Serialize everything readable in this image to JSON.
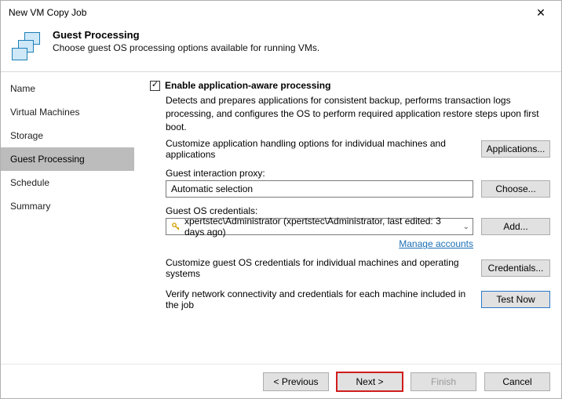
{
  "window": {
    "title": "New VM Copy Job",
    "close_glyph": "✕"
  },
  "header": {
    "title": "Guest Processing",
    "subtitle": "Choose guest OS processing options available for running VMs."
  },
  "sidebar": {
    "items": [
      {
        "label": "Name"
      },
      {
        "label": "Virtual Machines"
      },
      {
        "label": "Storage"
      },
      {
        "label": "Guest Processing",
        "selected": true
      },
      {
        "label": "Schedule"
      },
      {
        "label": "Summary"
      }
    ]
  },
  "content": {
    "enable_checkbox_label": "Enable application-aware processing",
    "enable_checkbox_checked": true,
    "enable_desc": "Detects and prepares applications for consistent backup, performs transaction logs processing, and configures the OS to perform required application restore steps upon first boot.",
    "customize_app_text": "Customize application handling options for individual machines and applications",
    "applications_btn": "Applications...",
    "proxy_label": "Guest interaction proxy:",
    "proxy_value": "Automatic selection",
    "choose_btn": "Choose...",
    "creds_label": "Guest OS credentials:",
    "creds_value": "xpertstec\\Administrator (xpertstec\\Administrator, last edited: 3 days ago)",
    "add_btn": "Add...",
    "manage_link": "Manage accounts",
    "customize_creds_text": "Customize guest OS credentials for individual machines and operating systems",
    "credentials_btn": "Credentials...",
    "verify_text": "Verify network connectivity and credentials for each machine included in the job",
    "test_btn": "Test Now"
  },
  "footer": {
    "previous": "< Previous",
    "next": "Next >",
    "finish": "Finish",
    "cancel": "Cancel"
  }
}
